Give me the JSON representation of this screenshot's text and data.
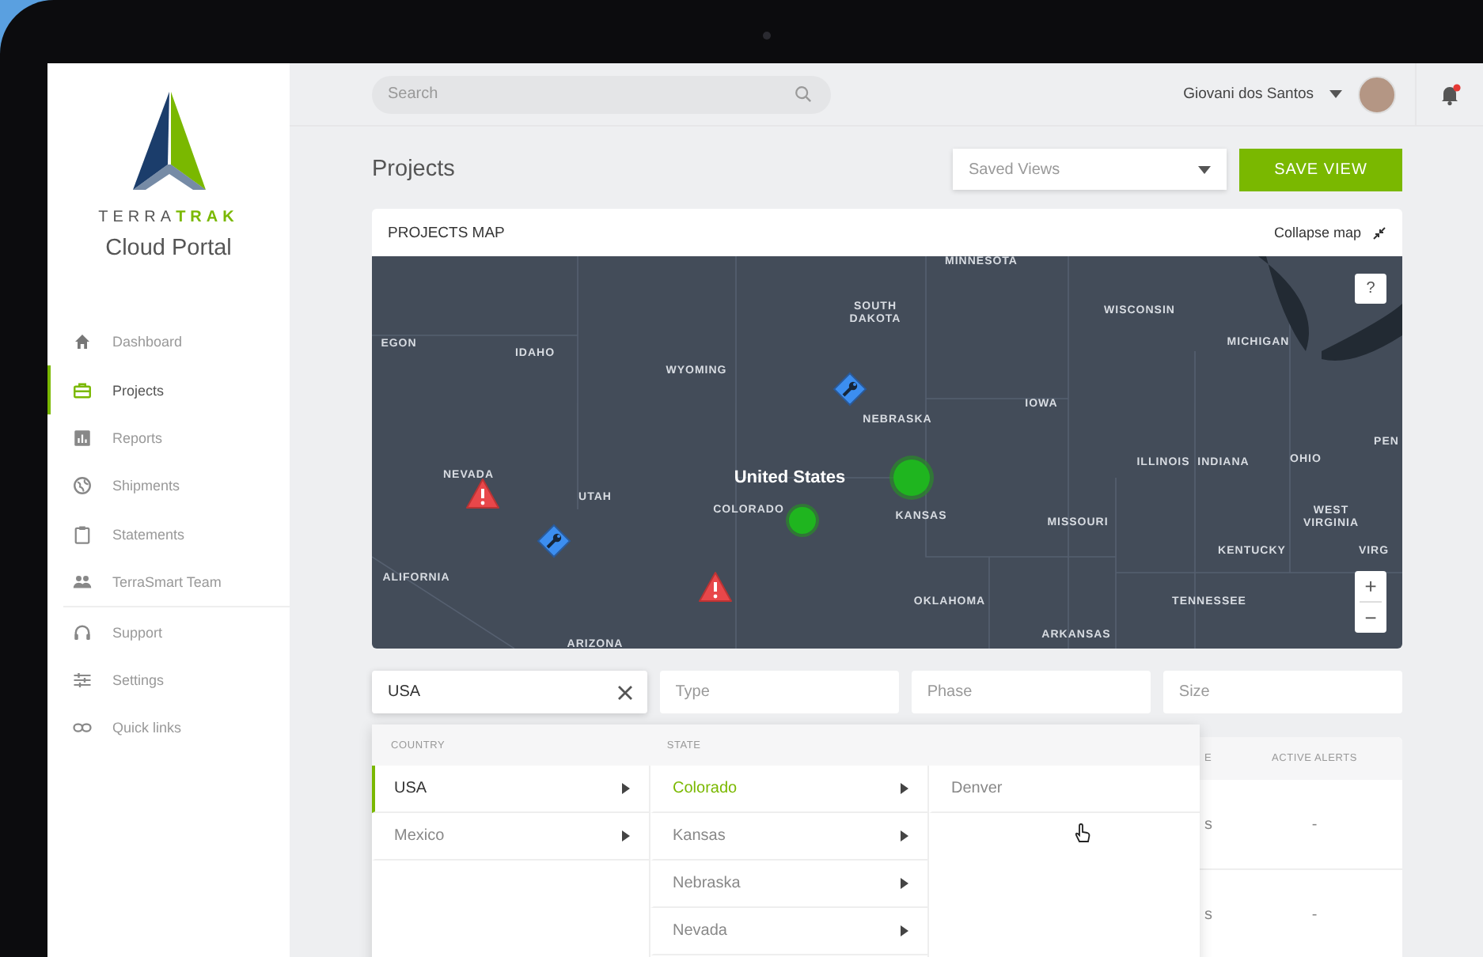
{
  "sidebar": {
    "brand_prefix": "TERRA",
    "brand_suffix": "TRAK",
    "subtitle": "Cloud Portal",
    "items": [
      {
        "label": "Dashboard",
        "selected": false
      },
      {
        "label": "Projects",
        "selected": true
      },
      {
        "label": "Reports",
        "selected": false
      },
      {
        "label": "Shipments",
        "selected": false
      },
      {
        "label": "Statements",
        "selected": false
      },
      {
        "label": "TerraSmart Team",
        "selected": false
      },
      {
        "label": "Support",
        "selected": false
      },
      {
        "label": "Settings",
        "selected": false
      },
      {
        "label": "Quick links",
        "selected": false
      }
    ]
  },
  "topbar": {
    "search": {
      "placeholder": "Search"
    },
    "user": {
      "name": "Giovani dos Santos"
    },
    "notifications": {
      "unread": true
    }
  },
  "page": {
    "title": "Projects",
    "saved_views": {
      "placeholder": "Saved Views"
    },
    "save_button": "SAVE VIEW"
  },
  "map_card": {
    "title": "PROJECTS MAP",
    "collapse": "Collapse map",
    "help": "?",
    "zoom_in": "+",
    "zoom_out": "−",
    "labels": [
      {
        "text": "MINNESOTA",
        "kind": "state"
      },
      {
        "text": "SOUTH DAKOTA",
        "kind": "state"
      },
      {
        "text": "WISCONSIN",
        "kind": "state"
      },
      {
        "text": "MICHIGAN",
        "kind": "state"
      },
      {
        "text": "EGON",
        "kind": "state"
      },
      {
        "text": "IDAHO",
        "kind": "state"
      },
      {
        "text": "WYOMING",
        "kind": "state"
      },
      {
        "text": "IOWA",
        "kind": "state"
      },
      {
        "text": "NEBRASKA",
        "kind": "state"
      },
      {
        "text": "PEN",
        "kind": "state"
      },
      {
        "text": "ILLINOIS",
        "kind": "state"
      },
      {
        "text": "INDIANA",
        "kind": "state"
      },
      {
        "text": "OHIO",
        "kind": "state"
      },
      {
        "text": "United States",
        "kind": "country"
      },
      {
        "text": "NEVADA",
        "kind": "state"
      },
      {
        "text": "UTAH",
        "kind": "state"
      },
      {
        "text": "COLORADO",
        "kind": "state"
      },
      {
        "text": "KANSAS",
        "kind": "state"
      },
      {
        "text": "MISSOURI",
        "kind": "state"
      },
      {
        "text": "WEST VIRGINIA",
        "kind": "state"
      },
      {
        "text": "KENTUCKY",
        "kind": "state"
      },
      {
        "text": "VIRG",
        "kind": "state"
      },
      {
        "text": "ALIFORNIA",
        "kind": "state"
      },
      {
        "text": "OKLAHOMA",
        "kind": "state"
      },
      {
        "text": "TENNESSEE",
        "kind": "state"
      },
      {
        "text": "ARKANSAS",
        "kind": "state"
      },
      {
        "text": "ARIZONA",
        "kind": "state"
      }
    ],
    "markers": [
      {
        "kind": "alert"
      },
      {
        "kind": "alert"
      },
      {
        "kind": "maintenance"
      },
      {
        "kind": "maintenance"
      },
      {
        "kind": "cluster"
      },
      {
        "kind": "site"
      }
    ]
  },
  "filters": [
    {
      "value": "USA"
    },
    {
      "placeholder": "Type"
    },
    {
      "placeholder": "Phase"
    },
    {
      "placeholder": "Size"
    }
  ],
  "table": {
    "columns": [
      "E",
      "ACTIVE ALERTS"
    ],
    "rows": [
      [
        "s",
        "-"
      ],
      [
        "s",
        "-"
      ]
    ]
  },
  "location_menu": {
    "columns": [
      {
        "heading": "COUNTRY",
        "items": [
          {
            "label": "USA",
            "selected": true,
            "has_children": true
          },
          {
            "label": "Mexico",
            "selected": false,
            "has_children": true
          }
        ]
      },
      {
        "heading": "STATE",
        "items": [
          {
            "label": "Colorado",
            "selected": true,
            "has_children": true
          },
          {
            "label": "Kansas",
            "selected": false,
            "has_children": true
          },
          {
            "label": "Nebraska",
            "selected": false,
            "has_children": true
          },
          {
            "label": "Nevada",
            "selected": false,
            "has_children": true
          }
        ]
      },
      {
        "items": [
          {
            "label": "Denver",
            "selected": false,
            "has_children": false
          }
        ]
      }
    ]
  }
}
